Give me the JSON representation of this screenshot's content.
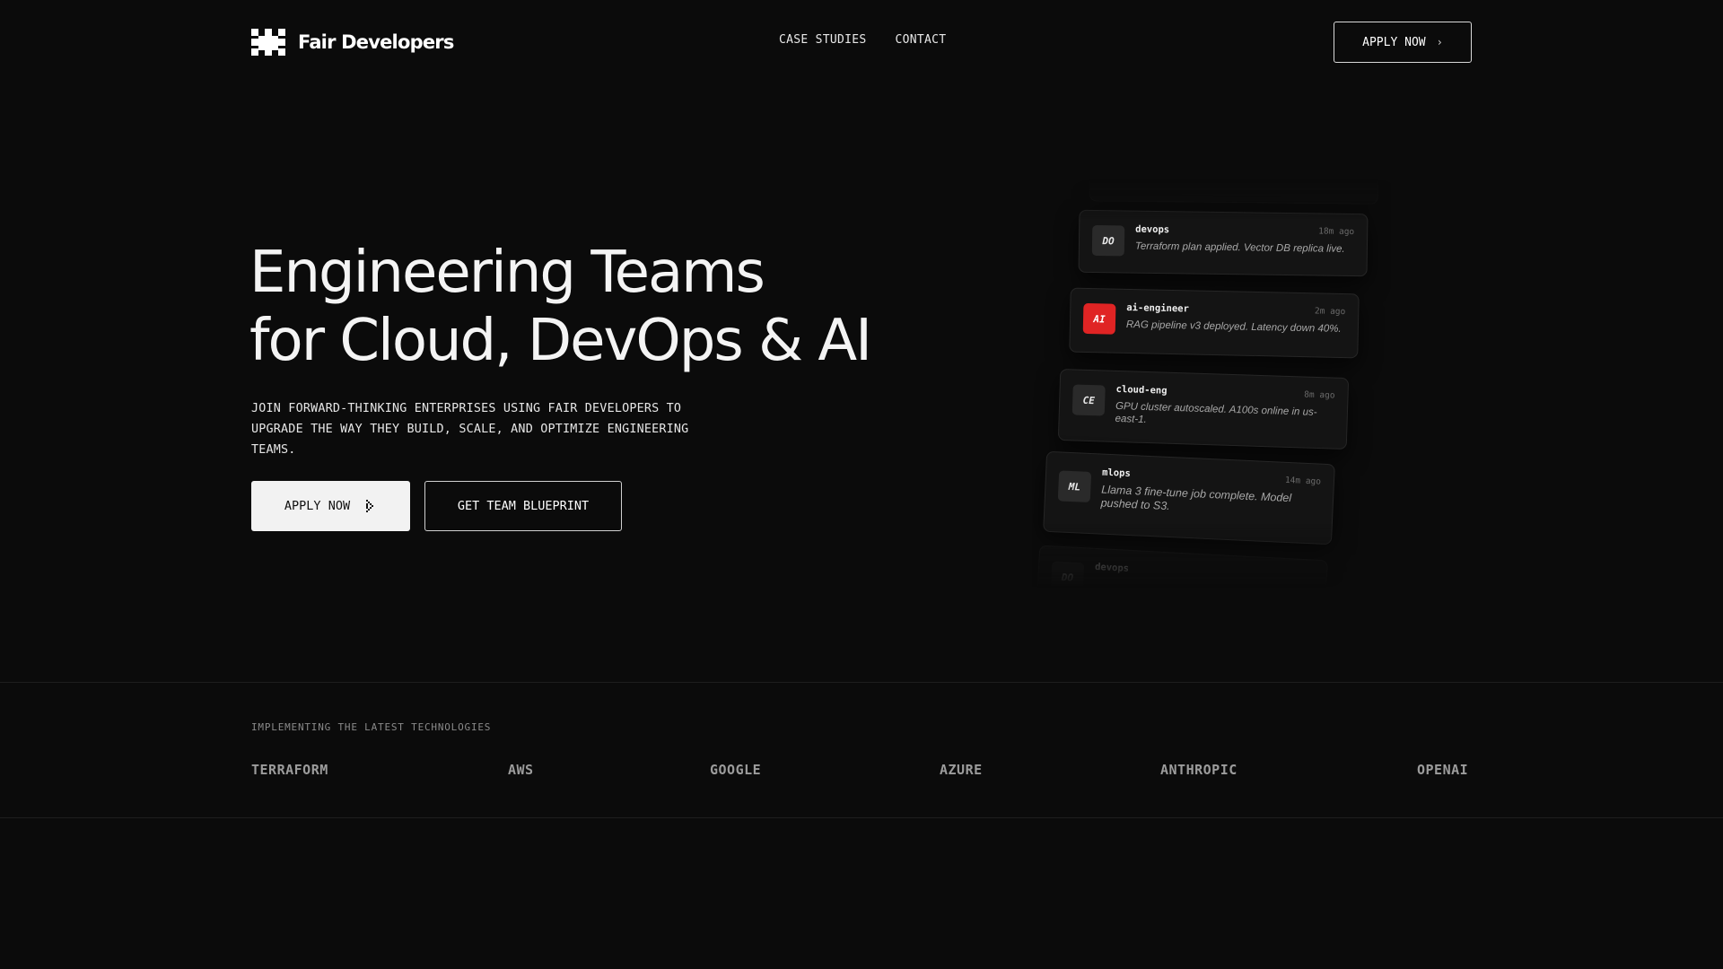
{
  "brand": {
    "name": "Fair Developers",
    "logo_icon": "pixel-asterisk-logo"
  },
  "nav": {
    "links": [
      "CASE STUDIES",
      "CONTACT"
    ],
    "cta_label": "APPLY NOW",
    "cta_icon": "chevron-right-icon"
  },
  "hero": {
    "title_line1": "Engineering Teams",
    "title_line2": "for Cloud, DevOps & AI",
    "subtitle": "JOIN FORWARD-THINKING ENTERPRISES USING FAIR DEVELOPERS TO UPGRADE THE WAY THEY BUILD, SCALE, AND OPTIMIZE ENGINEERING TEAMS.",
    "primary_button": "APPLY NOW",
    "primary_icon": "pointer-cursor-icon",
    "secondary_button": "GET TEAM BLUEPRINT"
  },
  "feed": [
    {
      "avatar": "DO",
      "name": "devops",
      "time": "18m ago",
      "message": "Terraform plan applied. Vector DB replica live.",
      "accent": "#2a2a2a"
    },
    {
      "avatar": "AI",
      "name": "ai-engineer",
      "time": "2m ago",
      "message": "RAG pipeline v3 deployed. Latency down 40%.",
      "accent": "#e02424"
    },
    {
      "avatar": "CE",
      "name": "cloud-eng",
      "time": "8m ago",
      "message": "GPU cluster autoscaled. A100s online in us-east-1.",
      "accent": "#2a2a2a"
    },
    {
      "avatar": "ML",
      "name": "mlops",
      "time": "14m ago",
      "message": "Llama 3 fine-tune job complete. Model pushed to S3.",
      "accent": "#2a2a2a"
    },
    {
      "avatar": "DO",
      "name": "devops",
      "time": "",
      "message": "",
      "accent": "#2a2a2a"
    }
  ],
  "technologies": {
    "label": "IMPLEMENTING THE LATEST TECHNOLOGIES",
    "logos": [
      "TERRAFORM",
      "AWS",
      "GOOGLE",
      "AZURE",
      "ANTHROPIC",
      "OPENAI"
    ]
  },
  "colors": {
    "background": "#0b0b0b",
    "accent_red": "#e02424",
    "primary_button_bg": "#f2f2f2"
  }
}
